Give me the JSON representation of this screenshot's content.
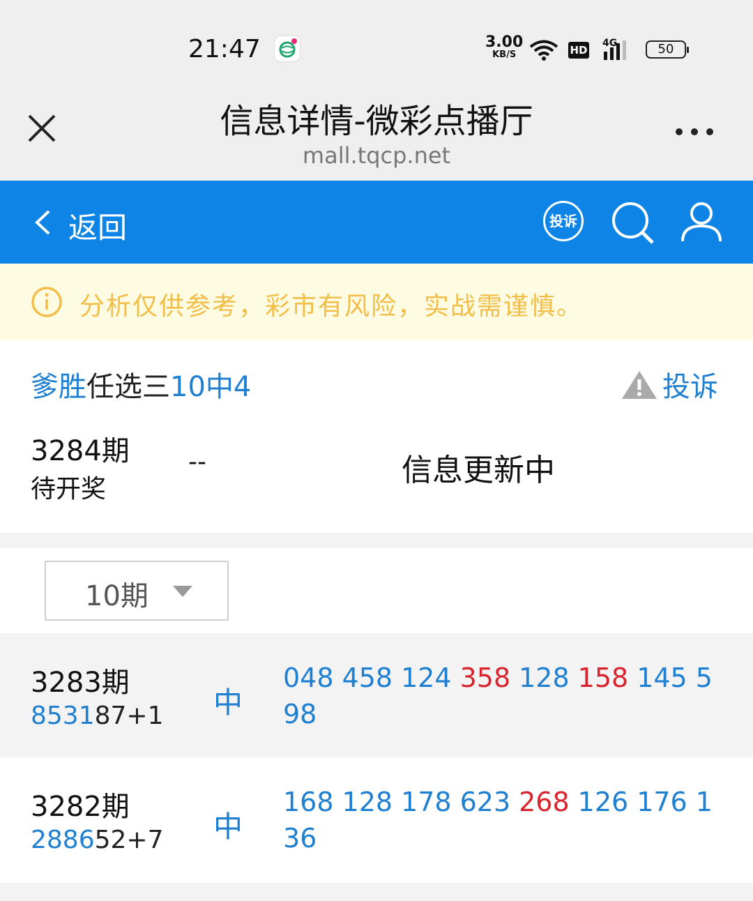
{
  "status_bar": {
    "time": "21:47",
    "speed_value": "3.00",
    "speed_unit": "KB/S",
    "hd": "HD",
    "network": "4G",
    "battery": "50"
  },
  "browser": {
    "title": "信息详情-微彩点播厅",
    "url": "mall.tqcp.net"
  },
  "nav": {
    "back_label": "返回",
    "complain_icon_label": "投诉"
  },
  "notice": {
    "text": "分析仅供参考，彩市有风险，实战需谨慎。"
  },
  "plan": {
    "author": "爹胜",
    "type": "任选三",
    "record": "10中4",
    "complain_label": "投诉"
  },
  "current": {
    "issue": "3284期",
    "status": "待开奖",
    "value": "--",
    "message": "信息更新中"
  },
  "filter": {
    "selected": "10期"
  },
  "history": [
    {
      "issue": "3283期",
      "code_hit": "8531",
      "code_rest": "87+1",
      "result": "中",
      "numbers": [
        {
          "n": "048",
          "hit": false
        },
        {
          "n": "458",
          "hit": false
        },
        {
          "n": "124",
          "hit": false
        },
        {
          "n": "358",
          "hit": true
        },
        {
          "n": "128",
          "hit": false
        },
        {
          "n": "158",
          "hit": true
        },
        {
          "n": "145",
          "hit": false
        },
        {
          "n": "598",
          "hit": false
        }
      ]
    },
    {
      "issue": "3282期",
      "code_hit": "2886",
      "code_rest": "52+7",
      "result": "中",
      "numbers": [
        {
          "n": "168",
          "hit": false
        },
        {
          "n": "128",
          "hit": false
        },
        {
          "n": "178",
          "hit": false
        },
        {
          "n": "623",
          "hit": false
        },
        {
          "n": "268",
          "hit": true
        },
        {
          "n": "126",
          "hit": false
        },
        {
          "n": "176",
          "hit": false
        },
        {
          "n": "136",
          "hit": false
        }
      ]
    }
  ],
  "colors": {
    "nav_blue": "#0d84e6",
    "link_blue": "#1f7fd0",
    "hit_red": "#d9232d",
    "notice_text": "#f2be47",
    "notice_bg": "#fefbe3"
  }
}
